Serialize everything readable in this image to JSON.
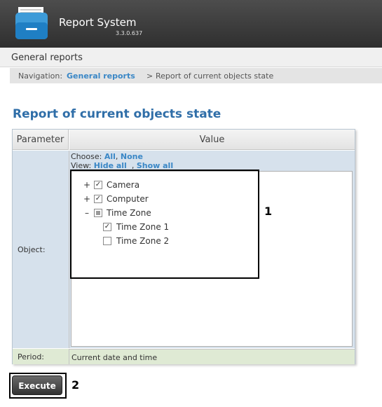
{
  "app": {
    "title": "Report System",
    "version": "3.3.0.637"
  },
  "subheader": {
    "title": "General reports"
  },
  "navigation": {
    "label": "Navigation:",
    "link": "General reports",
    "separator": ">",
    "current": "Report of current objects state"
  },
  "page": {
    "title": "Report of current objects state"
  },
  "table": {
    "headers": [
      "Parameter",
      "Value"
    ],
    "object": {
      "label": "Object:",
      "choose_label": "Choose:",
      "choose_all": "All",
      "choose_sep": ",",
      "choose_none": "None",
      "view_label": "View:",
      "view_hide": "Hide all",
      "view_sep": ",",
      "view_show": "Show all",
      "tree": [
        {
          "expander": "+",
          "label": "Camera",
          "checked": "✓"
        },
        {
          "expander": "+",
          "label": "Computer",
          "checked": "✓"
        },
        {
          "expander": "–",
          "label": "Time Zone",
          "checked": ""
        },
        {
          "expander": "",
          "label": "Time Zone 1",
          "checked": "✓"
        },
        {
          "expander": "",
          "label": "Time Zone 2",
          "checked": ""
        }
      ]
    },
    "period": {
      "label": "Period:",
      "value": "Current date and time"
    }
  },
  "execute_label": "Execute",
  "annotations": {
    "one": "1",
    "two": "2"
  }
}
